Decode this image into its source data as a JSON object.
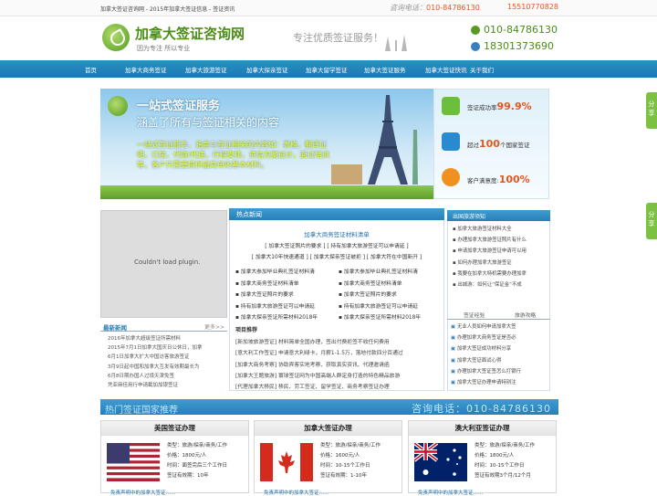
{
  "topbar": {
    "left": "加拿大签证咨询网 - 2015年加拿大签证信息 - 签证资讯",
    "hotline_label": "咨询电话：",
    "hotline": "010-84786130",
    "mobile": "15510770828"
  },
  "header": {
    "logo_title": "加拿大签证咨询网",
    "logo_sub": "因为专注  所以专业",
    "slogan": "专注优质签证服务！",
    "phone1": "010-84786130",
    "phone2": "18301373690"
  },
  "nav": [
    "首页",
    "加拿大商务签证",
    "加拿大旅游签证",
    "加拿大探亲签证",
    "加拿大留学签证",
    "加拿大签证服务",
    "加拿大签证快讯",
    "关于我们"
  ],
  "banner": {
    "title": "一站式签证服务",
    "subtitle": "涵盖了所有与签证相关的内容",
    "desc": "一站式签证服务，涵盖与签证相关的内容如：表格，翻译证明，订房，代取/代递，行程安排，资信方案设计，面试培训等，客户只需要提供最简单的基本材料。"
  },
  "stats": [
    {
      "pre": "签证成功率",
      "val": "99.9%",
      "post": ""
    },
    {
      "pre": "超过",
      "val": "100",
      "post": "个国家签证"
    },
    {
      "pre": "客户满意度:",
      "val": "100%",
      "post": ""
    }
  ],
  "left": {
    "plugin": "Couldn't load plugin.",
    "title": "最新新闻",
    "more": "更多>>",
    "items": [
      "2016年加拿大超级签证所需材料",
      "2015年7月1日加拿大国庆日公休日，加拿",
      "6月1日加拿大扩大中国访客旅游签证",
      "3月9日起中国和加拿大互发有效期最长为",
      "6月8日期办国人过境天津免签",
      "凭亚麻佳用行申请截加加银签证"
    ]
  },
  "news": {
    "header": "热点新闻",
    "headline": "加拿大商务签证材料清单",
    "line1": "[ 加拿大签证照片的要求 ] [ 持有加拿大旅游签证可以申请延 ]",
    "line2": "[ 加拿大10年快速通道 ] [ 加拿大探亲签证被拒 ] [ 加拿大符在中国新开 ]",
    "col1": [
      "加拿大参加毕业典礼签证材料清",
      "加拿大商务签证材料清单",
      "加拿大签证照片的要求",
      "持有加拿大旅游签证可以申请延",
      "加拿大探亲签证所需材料2018年"
    ],
    "col2": [
      "加拿大参加毕业典礼签证材料清",
      "加拿大商务签证材料清单",
      "加拿大签证照片的要求",
      "持有加拿大旅游签证可以申请延",
      "加拿大探亲签证所需材料2018年"
    ],
    "proj_title": "项目推荐",
    "proj": [
      "[新加坡旅游签证]  材料简单全国办理，签出付费拒签不收任何费用",
      "[意大利工作签证]  申请意大利绿卡，月薪1-1.5万，落地付款四分百通过",
      "[加拿大商务考察]  协助宾客实地考察、获取真实资讯、代理邀请函",
      "[加拿大王题旅游]  寰球签证网为中国高端人群定身打造的特色精品旅游",
      "[代理加拿大移民]  移民、劳工签证、留学签证、商务考察签证办理"
    ]
  },
  "right": {
    "header": "出国旅游须知",
    "items": [
      "加拿大旅游签证材料大全",
      "办理加拿大旅游签证照片有什么",
      "申请加拿大旅游签证申请可以用",
      "如何办理加拿大旅游签证",
      "我要在加拿大特机需要办理加拿",
      "出城游：如何让“保证金”不成"
    ],
    "tab1": "签证经验",
    "tab2": "旅游攻略",
    "items2": [
      "无业人员如何申请加拿大签",
      "办理加拿大商务签证是否必",
      "加拿大签证成功材料分享",
      "加拿大签证面试心得",
      "办理加拿大签证签怎么打银行",
      "加拿大签证办理申请特别注"
    ]
  },
  "hot": {
    "title": "热门签证国家推荐",
    "phone": "咨询电话：010-84786130"
  },
  "cards": [
    {
      "title": "美国签证办理",
      "type": "类型：旅游/探亲/商务/工作",
      "price": "价格：1800元/人",
      "time": "时间：面签完后三个工作日",
      "valid": "签证有效期：10年",
      "link": "免责声明中的加拿大签证……"
    },
    {
      "title": "加拿大签证办理",
      "type": "类型：旅游/探亲/商务/工作",
      "price": "价格：1600元/人",
      "time": "时间：10-15个工作日",
      "valid": "签证有效期：1-10年",
      "link": "免责声明中的加拿大签证……"
    },
    {
      "title": "澳大利亚签证办理",
      "type": "类型：旅游/探亲/商务/工作",
      "price": "价格：1800元/人",
      "time": "时间：10-15个工作日",
      "valid": "签证有效期3个月/12个月",
      "link": "免责声明中的加拿大签证……"
    }
  ],
  "side": {
    "a": "分享",
    "b": "分享"
  }
}
